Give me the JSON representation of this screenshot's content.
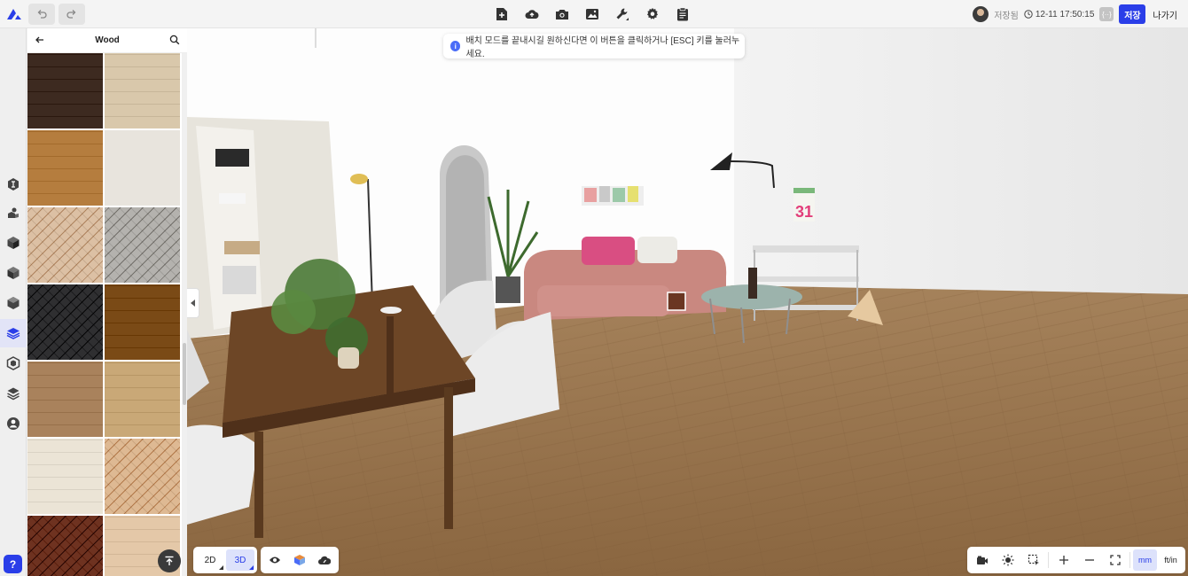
{
  "toolbar": {
    "undo_icon": "undo-icon",
    "redo_icon": "redo-icon",
    "tools": [
      "new-file-icon",
      "cloud-upload-icon",
      "camera-icon",
      "image-icon",
      "wrench-icon",
      "gear-icon",
      "clipboard-icon"
    ],
    "saved_label": "저장됨",
    "timestamp": "12-11 17:50:15",
    "code_label": "{··}",
    "save_label": "저장",
    "exit_label": "나가기"
  },
  "sidebar": {
    "icons": [
      "ai-icon",
      "user-object-icon",
      "box-icon",
      "box-alt-icon",
      "cube-icon",
      "material-layers-icon",
      "hex-box-icon",
      "stack-icon",
      "person-icon"
    ],
    "active_index": 5,
    "help_label": "?"
  },
  "panel": {
    "title": "Wood",
    "swatches": [
      {
        "color": "#3d2a20",
        "pattern": "plank"
      },
      {
        "color": "#d9c8ab",
        "pattern": "plank"
      },
      {
        "color": "#b57d3e",
        "pattern": "plank"
      },
      {
        "color": "#e8e4dd",
        "pattern": "plain"
      },
      {
        "color": "#dcc0a4",
        "pattern": "herringbone"
      },
      {
        "color": "#b4b2ae",
        "pattern": "herringbone"
      },
      {
        "color": "#2f2f31",
        "pattern": "herringbone"
      },
      {
        "color": "#7a4a16",
        "pattern": "plank"
      },
      {
        "color": "#a9825c",
        "pattern": "plank"
      },
      {
        "color": "#c9a877",
        "pattern": "plank"
      },
      {
        "color": "#ebe4d6",
        "pattern": "plank"
      },
      {
        "color": "#deb993",
        "pattern": "herringbone"
      },
      {
        "color": "#6e3220",
        "pattern": "herringbone"
      },
      {
        "color": "#e4c8a8",
        "pattern": "plank"
      }
    ]
  },
  "toast": {
    "message": "배치 모드를 끝내시길 원하신다면 이 버튼을 클릭하거나 [ESC] 키를 눌러누세요."
  },
  "view": {
    "btn_2d": "2D",
    "btn_3d": "3D",
    "active": "3D"
  },
  "bottom_right": {
    "unit_mm": "mm",
    "unit_ftin": "ft/in",
    "active_unit": "mm"
  }
}
